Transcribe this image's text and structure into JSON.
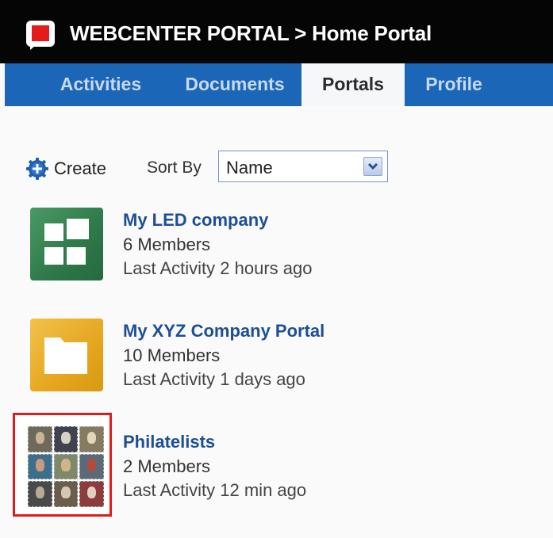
{
  "header": {
    "title": "WEBCENTER PORTAL > Home Portal",
    "logo_icon": "webcenter-logo-icon",
    "brand_color": "#e41b1b"
  },
  "tabs": [
    {
      "label": "Activities",
      "active": false
    },
    {
      "label": "Documents",
      "active": false
    },
    {
      "label": "Portals",
      "active": true
    },
    {
      "label": "Profile",
      "active": false
    }
  ],
  "toolbar": {
    "create_label": "Create",
    "create_icon": "add-circle-icon",
    "sort_label": "Sort By",
    "sort_value": "Name"
  },
  "portals": [
    {
      "name": "My LED company",
      "members": "6 Members",
      "activity": "Last Activity 2 hours ago",
      "icon": "grid-tiles-icon",
      "color": "#2e7849"
    },
    {
      "name": "My XYZ Company Portal",
      "members": "10 Members",
      "activity": "Last Activity 1 days ago",
      "icon": "folder-icon",
      "color": "#e6a61f"
    },
    {
      "name": "Philatelists",
      "members": "2 Members",
      "activity": "Last Activity 12 min ago",
      "icon": "stamp-collage-image",
      "selected": true
    }
  ]
}
